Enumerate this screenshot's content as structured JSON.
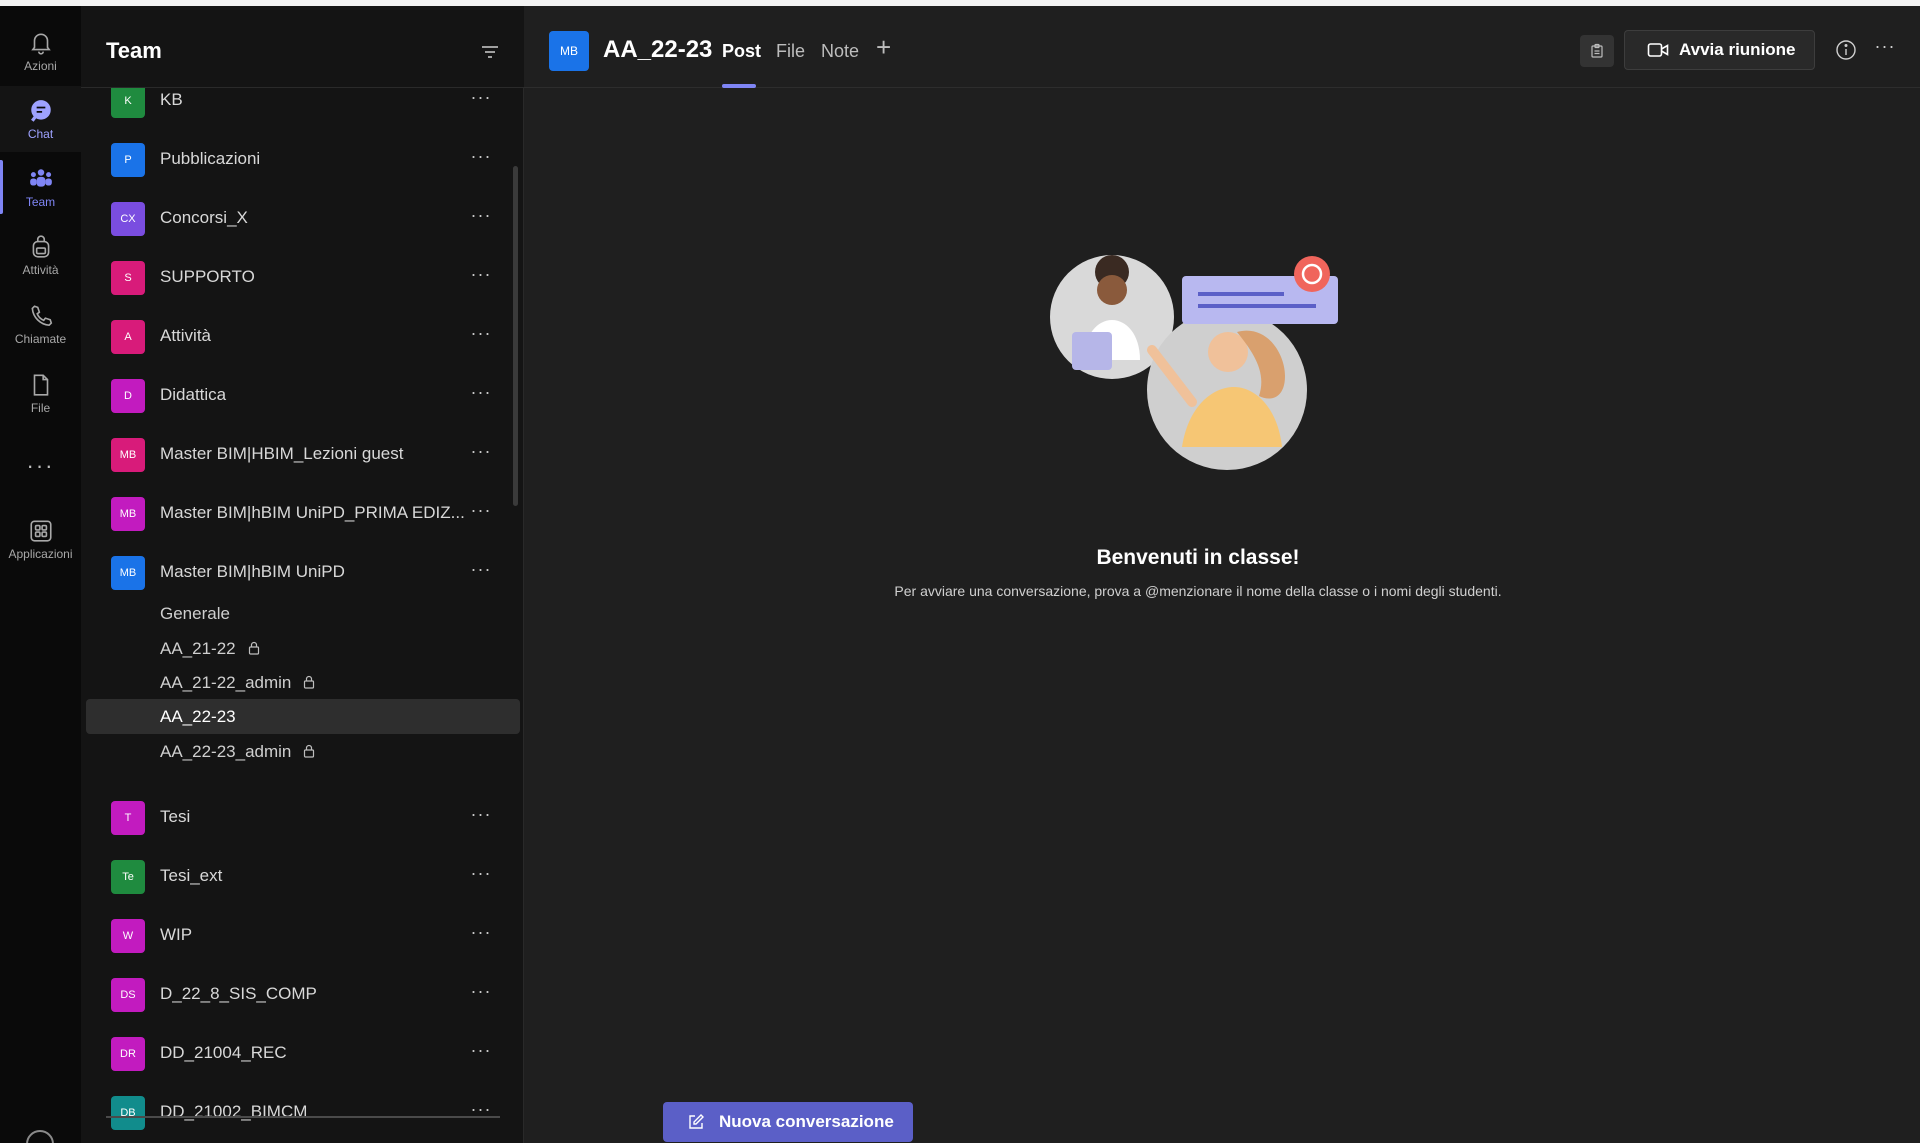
{
  "rail": {
    "items": [
      {
        "label": "Azioni",
        "icon": "bell-icon"
      },
      {
        "label": "Chat",
        "icon": "chat-icon"
      },
      {
        "label": "Team",
        "icon": "team-icon"
      },
      {
        "label": "Attività",
        "icon": "backpack-icon"
      },
      {
        "label": "Chiamate",
        "icon": "phone-icon"
      },
      {
        "label": "File",
        "icon": "file-icon"
      },
      {
        "label": "Applicazioni",
        "icon": "apps-icon"
      }
    ],
    "more": "···"
  },
  "team_list": {
    "title": "Team",
    "teams": [
      {
        "initials": "K",
        "name": "KB",
        "color": "#1f8b3f"
      },
      {
        "initials": "P",
        "name": "Pubblicazioni",
        "color": "#1a73e8"
      },
      {
        "initials": "CX",
        "name": "Concorsi_X",
        "color": "#7a4de0"
      },
      {
        "initials": "S",
        "name": "SUPPORTO",
        "color": "#d81b7a"
      },
      {
        "initials": "A",
        "name": "Attività",
        "color": "#d81b7a"
      },
      {
        "initials": "D",
        "name": "Didattica",
        "color": "#c21bbf"
      },
      {
        "initials": "MB",
        "name": "Master BIM|HBIM_Lezioni guest",
        "color": "#d81b7a"
      },
      {
        "initials": "MB",
        "name": "Master BIM|hBIM UniPD_PRIMA EDIZ...",
        "color": "#c21bbf"
      },
      {
        "initials": "MB",
        "name": "Master BIM|hBIM UniPD",
        "color": "#1a73e8"
      },
      {
        "initials": "T",
        "name": "Tesi",
        "color": "#c21bbf"
      },
      {
        "initials": "Te",
        "name": "Tesi_ext",
        "color": "#1f8b3f"
      },
      {
        "initials": "W",
        "name": "WIP",
        "color": "#c21bbf"
      },
      {
        "initials": "DS",
        "name": "D_22_8_SIS_COMP",
        "color": "#c21bbf"
      },
      {
        "initials": "DR",
        "name": "DD_21004_REC",
        "color": "#c21bbf"
      },
      {
        "initials": "DB",
        "name": "DD_21002_BIMCM",
        "color": "#118c8c"
      }
    ],
    "channels": [
      {
        "name": "Generale",
        "locked": false,
        "selected": false
      },
      {
        "name": "AA_21-22",
        "locked": true,
        "selected": false
      },
      {
        "name": "AA_21-22_admin",
        "locked": true,
        "selected": false
      },
      {
        "name": "AA_22-23",
        "locked": false,
        "selected": true
      },
      {
        "name": "AA_22-23_admin",
        "locked": true,
        "selected": false
      }
    ],
    "more_label": "···"
  },
  "main": {
    "avatar": "MB",
    "title": "AA_22-23",
    "tabs": [
      {
        "label": "Post",
        "active": true
      },
      {
        "label": "File",
        "active": false
      },
      {
        "label": "Note",
        "active": false
      }
    ],
    "add_tab": "+",
    "meet_button": "Avvia riunione",
    "more": "···",
    "welcome_title": "Benvenuti in classe!",
    "welcome_hint": "Per avviare una conversazione, prova a @menzionare il nome della classe o i nomi degli studenti.",
    "new_conversation": "Nuova conversazione"
  },
  "colors": {
    "accent": "#7f85f5",
    "button": "#5b5fc7"
  }
}
